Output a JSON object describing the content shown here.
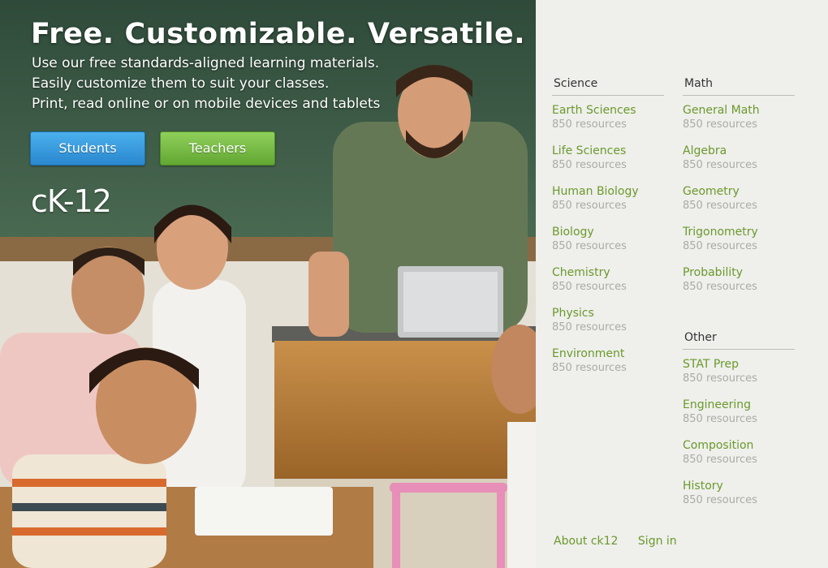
{
  "hero": {
    "title": "Free. Customizable. Versatile.",
    "lines": [
      "Use our free standards-aligned learning materials.",
      "Easily customize them to suit your classes.",
      "Print, read online or on mobile devices and tablets"
    ],
    "students_label": "Students",
    "teachers_label": "Teachers",
    "logo_text": "cK-12"
  },
  "panel": {
    "science": {
      "heading": "Science",
      "items": [
        {
          "name": "Earth Sciences",
          "count": "850 resources"
        },
        {
          "name": "Life Sciences",
          "count": "850 resources"
        },
        {
          "name": "Human Biology",
          "count": "850 resources"
        },
        {
          "name": "Biology",
          "count": "850 resources"
        },
        {
          "name": "Chemistry",
          "count": "850 resources"
        },
        {
          "name": "Physics",
          "count": "850 resources"
        },
        {
          "name": "Environment",
          "count": "850 resources"
        }
      ]
    },
    "math": {
      "heading": "Math",
      "items": [
        {
          "name": "General Math",
          "count": "850 resources"
        },
        {
          "name": "Algebra",
          "count": "850 resources"
        },
        {
          "name": "Geometry",
          "count": "850 resources"
        },
        {
          "name": "Trigonometry",
          "count": "850 resources"
        },
        {
          "name": "Probability",
          "count": "850 resources"
        }
      ]
    },
    "other": {
      "heading": "Other",
      "items": [
        {
          "name": "STAT Prep",
          "count": "850 resources"
        },
        {
          "name": "Engineering",
          "count": "850 resources"
        },
        {
          "name": "Composition",
          "count": "850 resources"
        },
        {
          "name": "History",
          "count": "850 resources"
        }
      ]
    },
    "footer": {
      "about": "About ck12",
      "signin": "Sign in"
    }
  },
  "colors": {
    "link_green": "#6a9a2b",
    "students_blue": "#2a88cf",
    "teachers_green": "#62a733",
    "chalkboard": "#3d5a45"
  }
}
